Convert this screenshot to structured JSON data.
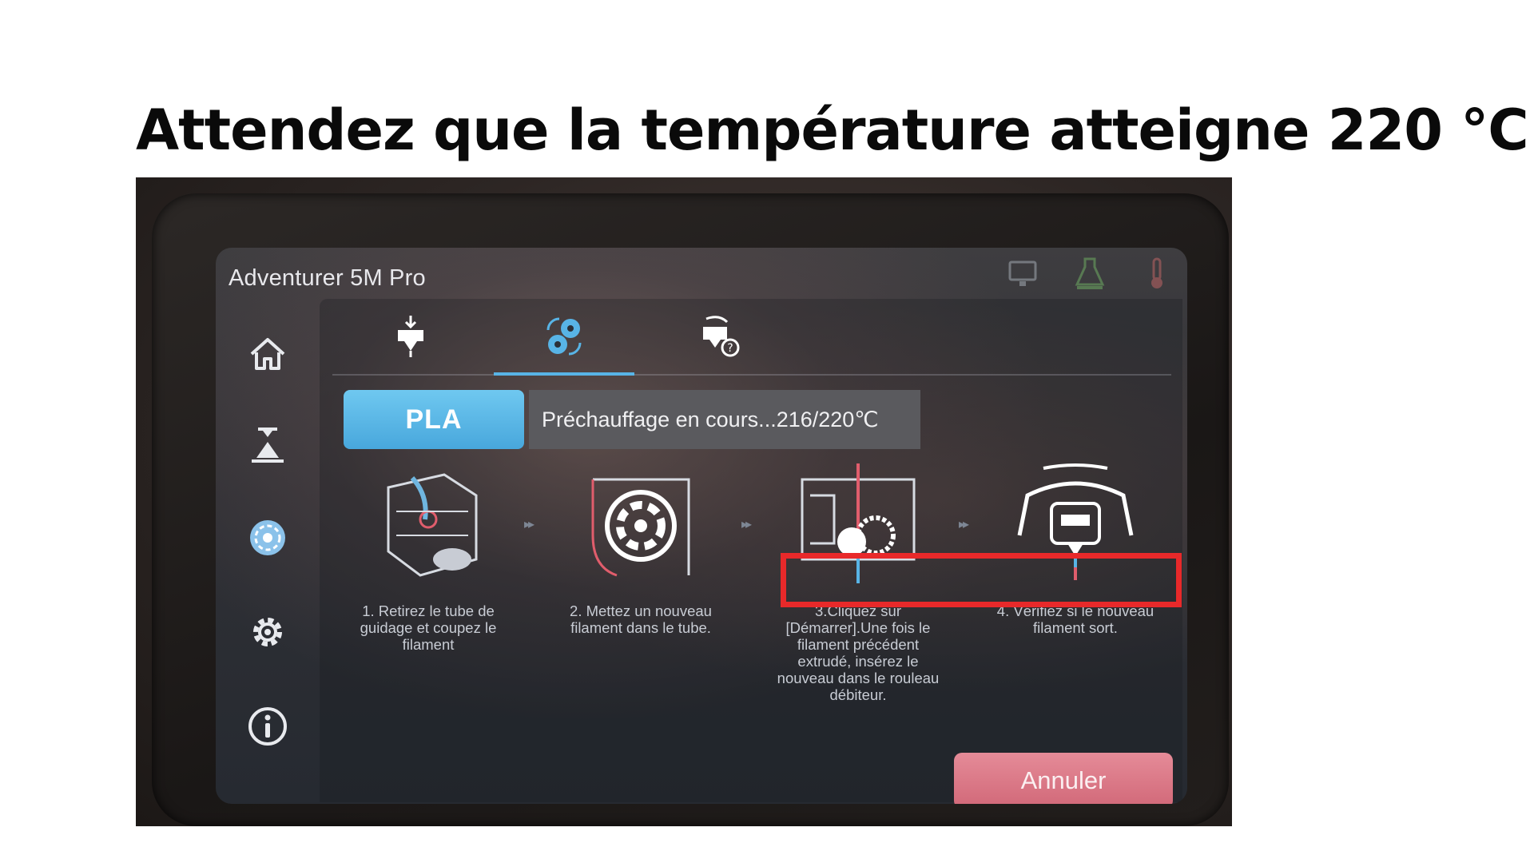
{
  "headline": "Attendez que la température atteigne 220 °C",
  "screen": {
    "title": "Adventurer 5M Pro",
    "status_icons": [
      "monitor-icon",
      "printer-flask-icon",
      "thermometer-icon"
    ],
    "sidebar": [
      {
        "name": "home-icon",
        "active": false
      },
      {
        "name": "print-nozzle-icon",
        "active": false
      },
      {
        "name": "filament-spool-icon",
        "active": true
      },
      {
        "name": "gear-icon",
        "active": false
      },
      {
        "name": "info-icon",
        "active": false
      }
    ],
    "tabs": [
      {
        "name": "load-filament-icon",
        "active": false
      },
      {
        "name": "change-filament-icon",
        "active": true
      },
      {
        "name": "filament-help-icon",
        "active": false
      }
    ],
    "material_label": "PLA",
    "preheat_text": "Préchauffage en cours...216/220℃",
    "current_temp": 216,
    "target_temp": 220,
    "steps": [
      {
        "text": "1. Retirez le tube de guidage et coupez le filament"
      },
      {
        "text": "2. Mettez un nouveau filament dans le tube."
      },
      {
        "text": "3.Cliquez sur [Démarrer].Une fois le filament précédent extrudé, insérez le nouveau dans le rouleau débiteur."
      },
      {
        "text": "4. Vérifiez si le nouveau filament sort."
      }
    ],
    "cancel_label": "Annuler"
  },
  "colors": {
    "accent": "#58b4e6",
    "cancel": "#d16878",
    "highlight": "#e8292a"
  }
}
